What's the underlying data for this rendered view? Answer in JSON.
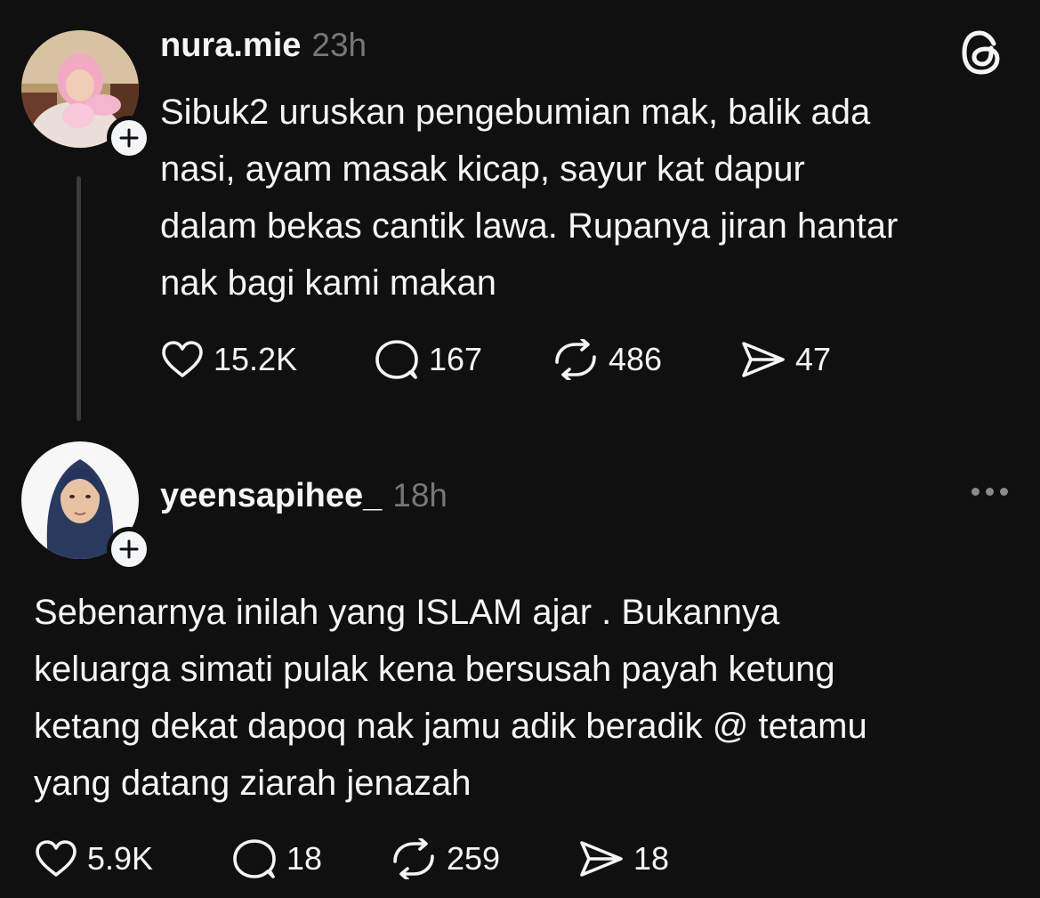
{
  "posts": [
    {
      "username": "nura.mie",
      "time": "23h",
      "text": "Sibuk2 uruskan pengebumian mak, balik ada\nnasi, ayam masak kicap, sayur kat dapur\ndalam bekas cantik lawa. Rupanya jiran hantar\nnak bagi kami makan",
      "likes": "15.2K",
      "replies": "167",
      "reposts": "486",
      "shares": "47"
    },
    {
      "username": "yeensapihee_",
      "time": "18h",
      "text": "Sebenarnya inilah yang ISLAM ajar . Bukannya\nkeluarga simati pulak kena bersusah payah ketung\nketang dekat dapoq nak jamu adik beradik @ tetamu\nyang datang ziarah jenazah",
      "likes": "5.9K",
      "replies": "18",
      "reposts": "259",
      "shares": "18"
    }
  ],
  "icons": {
    "like": "heart-icon",
    "reply": "comment-icon",
    "repost": "repost-icon",
    "share": "share-icon",
    "follow": "plus-icon",
    "app": "threads-logo-icon",
    "menu": "more-icon"
  },
  "colors": {
    "background": "#101010",
    "text": "#f3f5f7",
    "muted": "#777777",
    "thread_line": "#3a3a3a"
  }
}
